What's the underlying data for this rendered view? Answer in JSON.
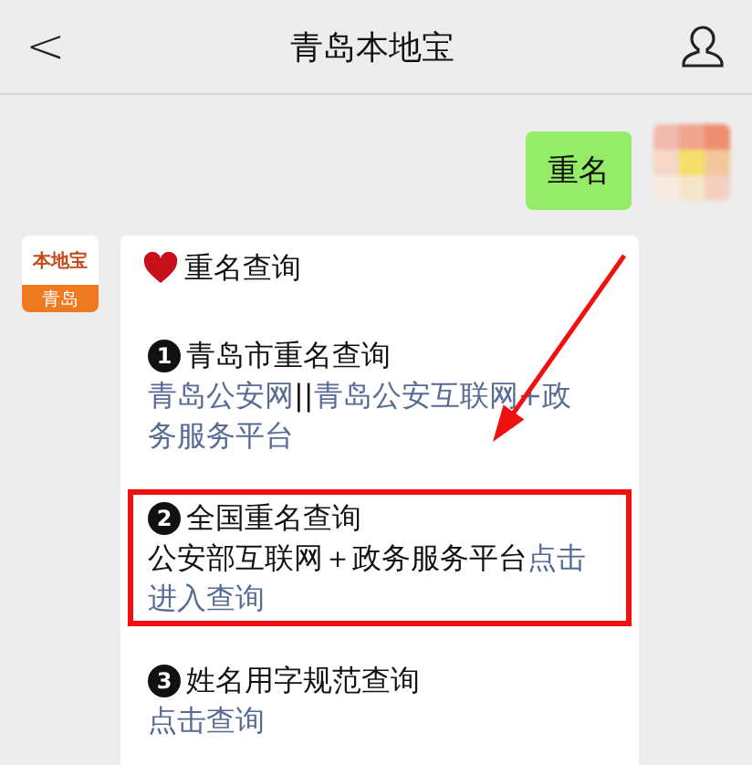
{
  "header": {
    "back": "<",
    "title": "青岛本地宝"
  },
  "outgoing": {
    "text": "重名"
  },
  "incoming": {
    "logo": {
      "top": "本地宝",
      "bottom": "青岛"
    },
    "title": "重名查询",
    "sections": [
      {
        "number": "1",
        "title": "青岛市重名查询",
        "highlighted": false,
        "lines": [
          [
            {
              "text": "青岛公安网",
              "kind": "link"
            },
            {
              "text": "||",
              "kind": "plain"
            },
            {
              "text": "青岛公安互联网+政",
              "kind": "link"
            }
          ],
          [
            {
              "text": "务服务平台",
              "kind": "link"
            }
          ]
        ]
      },
      {
        "number": "2",
        "title": "全国重名查询",
        "highlighted": true,
        "lines": [
          [
            {
              "text": "公安部互联网＋政务服务平台",
              "kind": "plain"
            },
            {
              "text": "点击",
              "kind": "link"
            }
          ],
          [
            {
              "text": "进入查询",
              "kind": "link"
            }
          ]
        ]
      },
      {
        "number": "3",
        "title": "姓名用字规范查询",
        "highlighted": false,
        "lines": [
          [
            {
              "text": "点击查询",
              "kind": "link"
            }
          ]
        ]
      }
    ]
  }
}
